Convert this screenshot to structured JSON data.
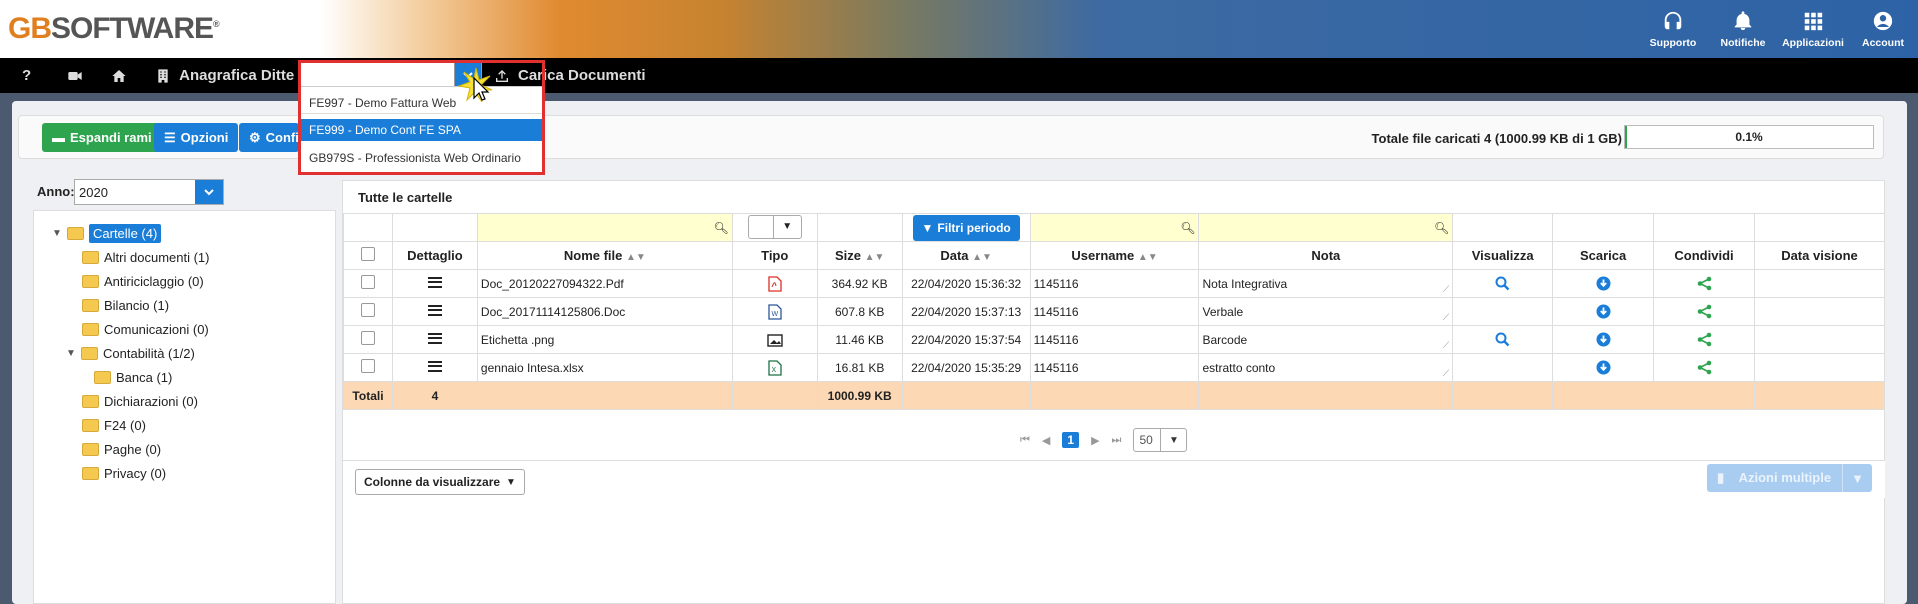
{
  "header": {
    "logo_prefix": "GB",
    "logo_text": "SOFTWARE",
    "logo_mark": "®",
    "icons": [
      {
        "name": "headset-icon",
        "label": "Supporto"
      },
      {
        "name": "bell-icon",
        "label": "Notifiche"
      },
      {
        "name": "apps-grid-icon",
        "label": "Applicazioni"
      },
      {
        "name": "account-circle-icon",
        "label": "Account"
      }
    ]
  },
  "menubar": {
    "help": "?",
    "anagrafica_label": "Anagrafica Ditte",
    "carica_label": "Carica Documenti",
    "combo_value": ""
  },
  "dropdown": {
    "options": [
      "FE997 - Demo Fattura Web",
      "FE999 - Demo Cont FE SPA",
      "GB979S - Professionista Web Ordinario"
    ],
    "selected_index": 1
  },
  "toolbar": {
    "espandi": "Espandi rami",
    "opzioni": "Opzioni",
    "config": "Confi",
    "totale": "Totale file caricati 4 (1000.99 KB di 1 GB)",
    "progress_text": "0.1%",
    "progress_fraction": 0.001
  },
  "sidebar": {
    "anno_label": "Anno:",
    "anno_value": "2020",
    "tree": [
      {
        "label": "Cartelle (4)",
        "level": 0,
        "expanded": true,
        "selected": true
      },
      {
        "label": "Altri documenti (1)",
        "level": 1
      },
      {
        "label": "Antiriciclaggio (0)",
        "level": 1
      },
      {
        "label": "Bilancio (1)",
        "level": 1
      },
      {
        "label": "Comunicazioni (0)",
        "level": 1
      },
      {
        "label": "Contabilità (1/2)",
        "level": 1,
        "expanded": true
      },
      {
        "label": "Banca (1)",
        "level": 2
      },
      {
        "label": "Dichiarazioni (0)",
        "level": 1
      },
      {
        "label": "F24 (0)",
        "level": 1
      },
      {
        "label": "Paghe (0)",
        "level": 1
      },
      {
        "label": "Privacy (0)",
        "level": 1
      }
    ]
  },
  "grid": {
    "title": "Tutte le cartelle",
    "filtri_label": "Filtri periodo",
    "columns": [
      "Dettaglio",
      "Nome file",
      "Tipo",
      "Size",
      "Data",
      "Username",
      "Nota",
      "Visualizza",
      "Scarica",
      "Condividi",
      "Data visione"
    ],
    "rows": [
      {
        "nome": "Doc_20120227094322.Pdf",
        "tipo": "pdf-file-icon",
        "size": "364.92 KB",
        "data": "22/04/2020 15:36:32",
        "username": "1145116",
        "nota": "Nota Integrativa",
        "visualizza": true
      },
      {
        "nome": "Doc_20171114125806.Doc",
        "tipo": "word-file-icon",
        "size": "607.8 KB",
        "data": "22/04/2020 15:37:13",
        "username": "1145116",
        "nota": "Verbale",
        "visualizza": false
      },
      {
        "nome": "Etichetta .png",
        "tipo": "image-file-icon",
        "size": "11.46 KB",
        "data": "22/04/2020 15:37:54",
        "username": "1145116",
        "nota": "Barcode",
        "visualizza": true
      },
      {
        "nome": "gennaio Intesa.xlsx",
        "tipo": "excel-file-icon",
        "size": "16.81 KB",
        "data": "22/04/2020 15:35:29",
        "username": "1145116",
        "nota": "estratto conto",
        "visualizza": false
      }
    ],
    "totals": {
      "label": "Totali",
      "count": "4",
      "size": "1000.99 KB"
    }
  },
  "pager": {
    "page": "1",
    "page_size": "50"
  },
  "footer": {
    "colonne": "Colonne da visualizzare",
    "azioni": "Azioni multiple"
  },
  "colors": {
    "accent": "#1a7ed8",
    "green": "#2ea44f",
    "totals_row": "#fdd8b5",
    "filter_cell": "#ffffd0"
  }
}
